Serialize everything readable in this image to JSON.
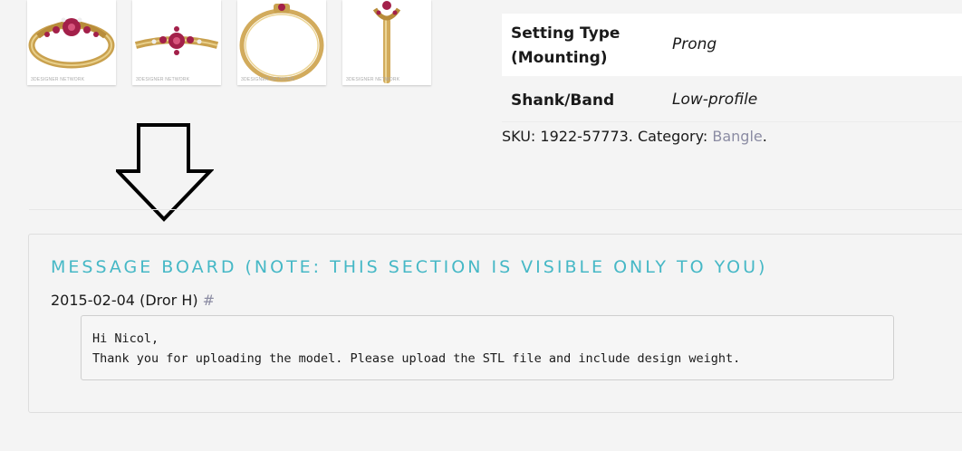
{
  "gallery": {
    "thumbnails": [
      {
        "alt": "bangle-front-view",
        "watermark": "3DESIGNER NETWORK"
      },
      {
        "alt": "bangle-top-view",
        "watermark": "3DESIGNER NETWORK"
      },
      {
        "alt": "bangle-profile-view",
        "watermark": "3DESIGNER NETWORK"
      },
      {
        "alt": "bangle-side-view",
        "watermark": "3DESIGNER NETWORK"
      }
    ]
  },
  "specs": {
    "rows": [
      {
        "label": "Setting Type (Mounting)",
        "value": "Prong"
      },
      {
        "label": "Shank/Band",
        "value": "Low-profile"
      }
    ]
  },
  "product_meta": {
    "sku_prefix": "SKU: 1922-57773. Category: ",
    "category": "Bangle",
    "suffix": "."
  },
  "message_board": {
    "title": "MESSAGE BOARD (NOTE: THIS SECTION IS VISIBLE ONLY TO YOU)",
    "message": {
      "date_author": "2015-02-04 (Dror H) ",
      "permalink": "#",
      "body": "Hi Nicol,\nThank you for uploading the model. Please upload the STL file and include design weight."
    }
  },
  "colors": {
    "accent": "#46b8c6",
    "link": "#8b8ca3",
    "background": "#f4f4f4",
    "gold": "#d9b25a",
    "ruby": "#a3204a"
  },
  "icons": {
    "arrow": "down-arrow-outline"
  }
}
